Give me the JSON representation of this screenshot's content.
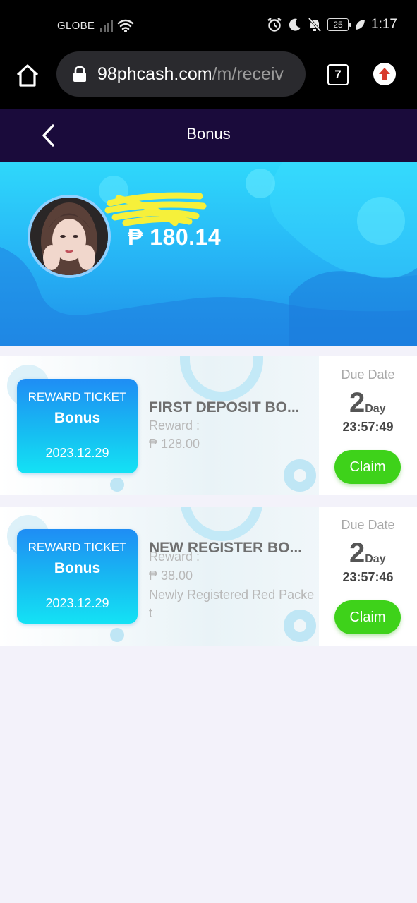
{
  "status_bar": {
    "carrier": "GLOBE",
    "battery": "25",
    "time": "1:17"
  },
  "browser": {
    "url_host": "98phcash.com",
    "url_path": "/m/receiv",
    "tabs_count": "7"
  },
  "header": {
    "title": "Bonus"
  },
  "profile": {
    "balance": "₱ 180.14"
  },
  "bonuses": [
    {
      "ticket_label": "REWARD TICKET",
      "ticket_title": "Bonus",
      "ticket_date": "2023.12.29",
      "title": "FIRST DEPOSIT BO...",
      "reward_label": "Reward :",
      "reward_value": "₱ 128.00",
      "description": "",
      "due_label": "Due Date",
      "days": "2",
      "days_unit": "Day",
      "countdown": "23:57:49",
      "claim_label": "Claim"
    },
    {
      "ticket_label": "REWARD TICKET",
      "ticket_title": "Bonus",
      "ticket_date": "2023.12.29",
      "title": "NEW REGISTER BO...",
      "reward_label": "Reward :",
      "reward_value": "₱ 38.00",
      "description": "Newly Registered Red Packet",
      "due_label": "Due Date",
      "days": "2",
      "days_unit": "Day",
      "countdown": "23:57:46",
      "claim_label": "Claim"
    }
  ],
  "colors": {
    "header_bg": "#1a0b3b",
    "hero_top": "#2fd8fb",
    "hero_bottom": "#1f8fe8",
    "claim_green": "#3ed21a",
    "ticket_blue": "#1f8df4"
  }
}
